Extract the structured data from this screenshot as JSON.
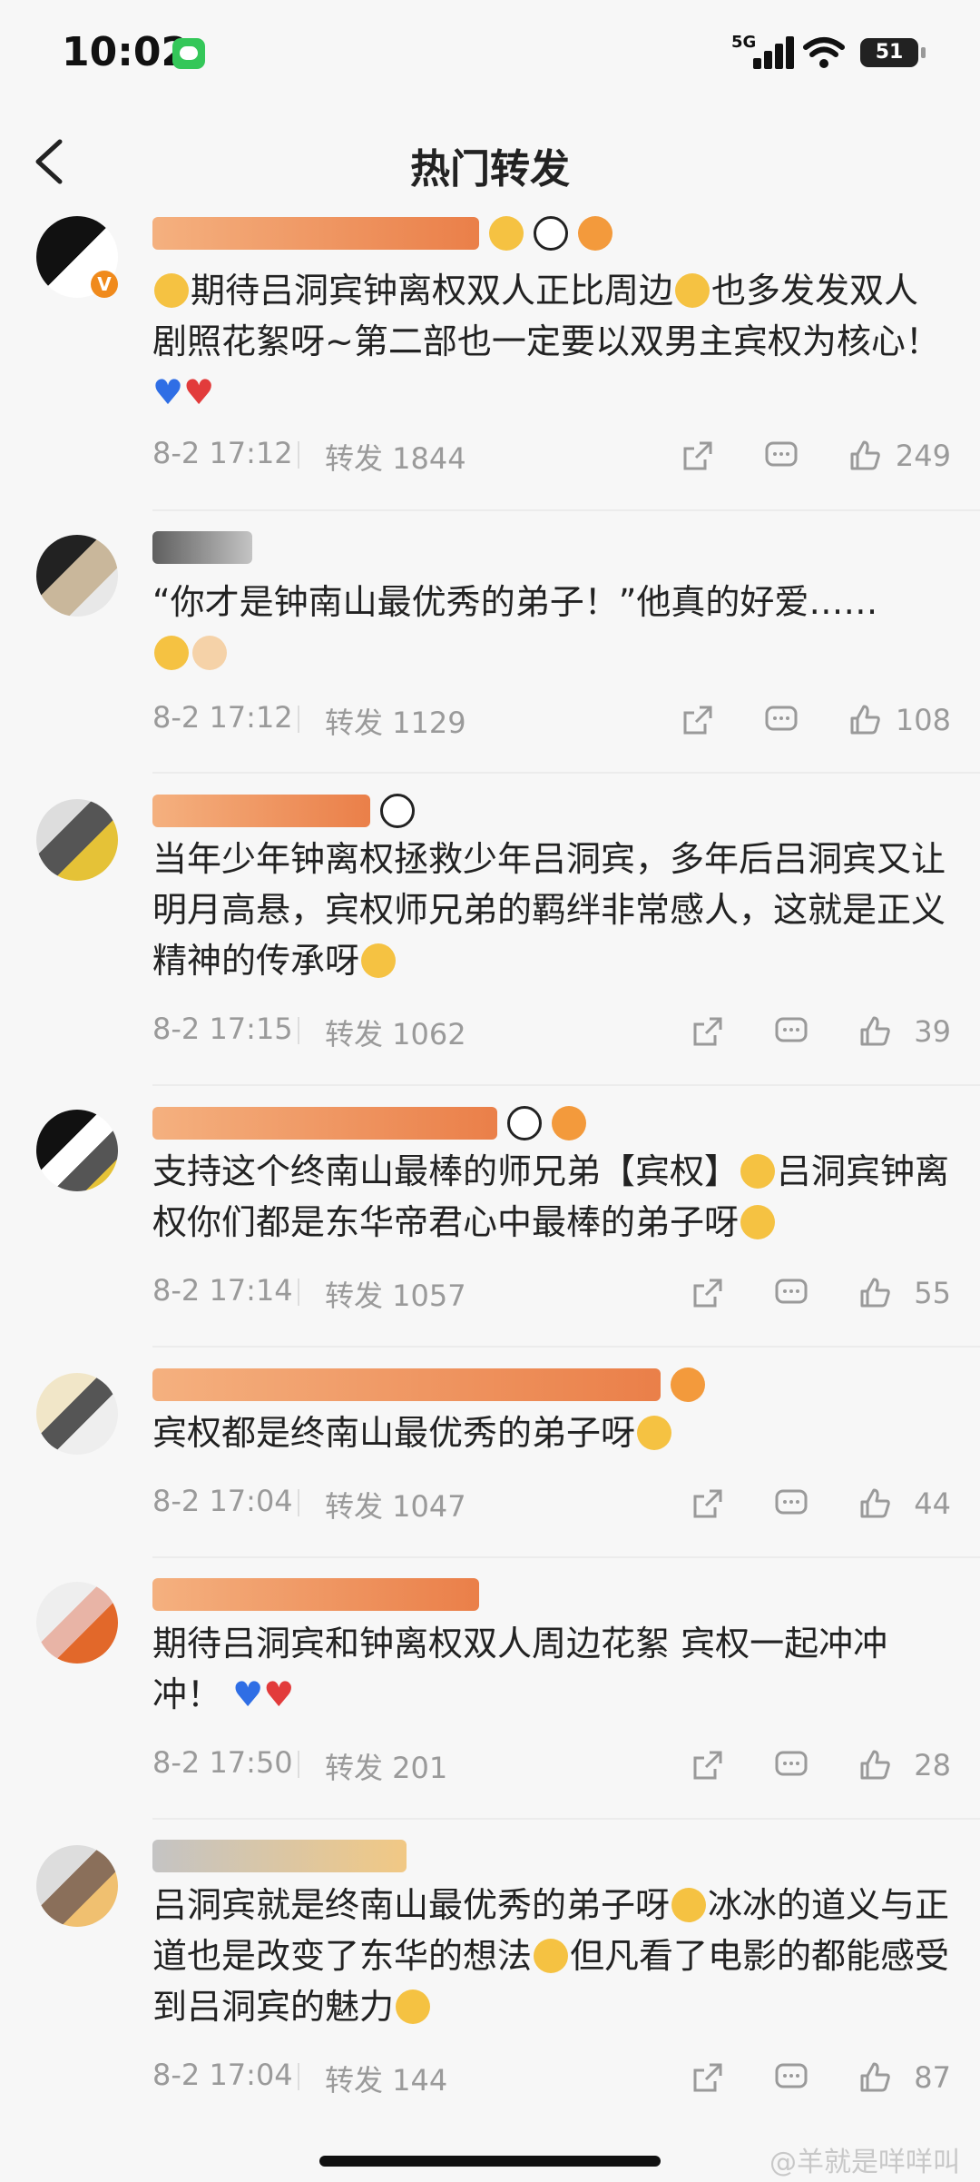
{
  "status_bar": {
    "time": "10:02",
    "network": "5G",
    "battery": "51"
  },
  "nav": {
    "title": "热门转发"
  },
  "comments": [
    {
      "text": "期待吕洞宾钟离权双人正比周边",
      "text2": "也多发发双人剧照花絮呀~第二部也一定要以双男主宾权为核心！",
      "time": "8-2 17:12",
      "repost": "转发 1844",
      "likes": "249"
    },
    {
      "text": "“你才是钟南山最优秀的弟子！”他真的好爱……",
      "time": "8-2 17:12",
      "repost": "转发 1129",
      "likes": "108"
    },
    {
      "text": "当年少年钟离权拯救少年吕洞宾，多年后吕洞宾又让明月高悬，宾权师兄弟的羁绊非常感人，这就是正义精神的传承呀",
      "time": "8-2 17:15",
      "repost": "转发 1062",
      "likes": "39"
    },
    {
      "text": "支持这个终南山最棒的师兄弟【宾权】",
      "text2": "吕洞宾钟离权你们都是东华帝君心中最棒的弟子呀",
      "time": "8-2 17:14",
      "repost": "转发 1057",
      "likes": "55"
    },
    {
      "text": "宾权都是终南山最优秀的弟子呀",
      "time": "8-2 17:04",
      "repost": "转发 1047",
      "likes": "44"
    },
    {
      "text": "期待吕洞宾和钟离权双人周边花絮 宾权一起冲冲冲！",
      "time": "8-2 17:50",
      "repost": "转发 201",
      "likes": "28"
    },
    {
      "text": "吕洞宾就是终南山最优秀的弟子呀",
      "text2": "冰冰的道义与正道也是改变了东华的想法",
      "text3": "但凡看了电影的都能感受到吕洞宾的魅力",
      "time": "8-2 17:04",
      "repost": "转发 144",
      "likes": "87"
    }
  ],
  "watermark": "@羊就是咩咩叫",
  "icons": {
    "share": "share-icon",
    "comment": "comment-icon",
    "like": "like-icon",
    "back": "chevron-left-icon"
  },
  "colors": {
    "background": "#f7f7f7",
    "meta_text": "#9a9a9a",
    "heart_blue": "#2f6ee5",
    "heart_red": "#e23b3b"
  }
}
